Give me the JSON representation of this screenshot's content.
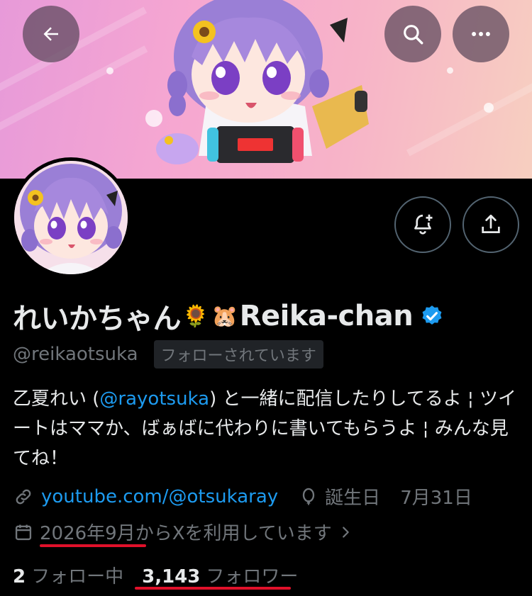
{
  "header": {
    "back_icon": "arrow-left-icon",
    "search_icon": "search-icon",
    "more_icon": "more-horizontal-icon",
    "banner_colors": [
      "#e79ad9",
      "#f7cfc0"
    ]
  },
  "profile": {
    "display_name_jp": "れいかちゃん",
    "display_name_en": "Reika-chan",
    "emoji_1": "🌻",
    "emoji_2": "🐹",
    "verified_icon": "verified-badge-icon",
    "handle": "@reikaotsuka",
    "follows_you": "フォローされています",
    "notify_icon": "bell-plus-icon",
    "share_icon": "share-icon"
  },
  "bio": {
    "part1": "乙夏れい (",
    "mention": "@rayotsuka",
    "part2": ") と一緒に配信したりしてるよ ¦ ツイートはママか、ばぁばに代わりに書いてもらうよ ¦ みんな見てね！"
  },
  "meta": {
    "link_icon": "link-icon",
    "link": "youtube.com/@otsukaray",
    "birthday_icon": "balloon-icon",
    "birthday_label": "誕生日",
    "birthday_date": "7月31日",
    "calendar_icon": "calendar-icon",
    "joined_date": "2026年9月",
    "joined_suffix": "からXを利用しています",
    "chevron_icon": "chevron-right-icon"
  },
  "stats": {
    "following_count": "2",
    "following_label": "フォロー中",
    "followers_count": "3,143",
    "followers_label": "フォロワー"
  },
  "colors": {
    "accent": "#1d9bf0",
    "annotation_underline": "#e0102a",
    "muted": "#71767b"
  }
}
